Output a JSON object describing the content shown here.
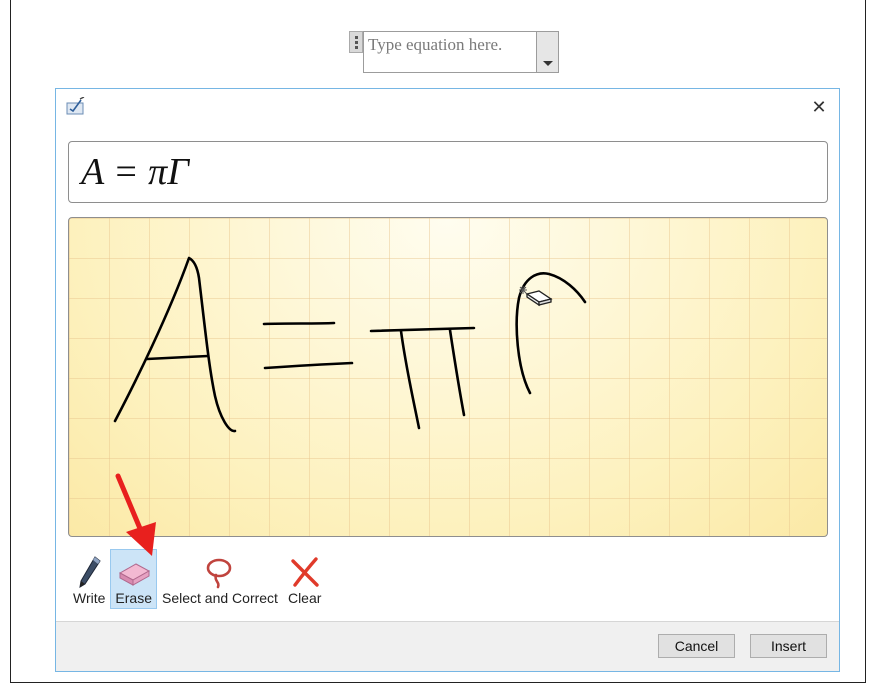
{
  "equation_placeholder": {
    "text": "Type equation here."
  },
  "dialog": {
    "title_icon": "math-input-icon",
    "close_label": "✕",
    "preview_expression": "A = πΓ",
    "tools": [
      {
        "label": "Write",
        "icon": "pen-icon",
        "selected": false
      },
      {
        "label": "Erase",
        "icon": "eraser-icon",
        "selected": true
      },
      {
        "label": "Select and Correct",
        "icon": "lasso-icon",
        "selected": false
      },
      {
        "label": "Clear",
        "icon": "clear-icon",
        "selected": false
      }
    ],
    "buttons": {
      "cancel": "Cancel",
      "insert": "Insert"
    }
  },
  "colors": {
    "canvas": "#fdf3c2",
    "selected_tool": "#cce4f7",
    "annotation_arrow": "#e8201e",
    "dialog_border": "#76b6e4"
  }
}
